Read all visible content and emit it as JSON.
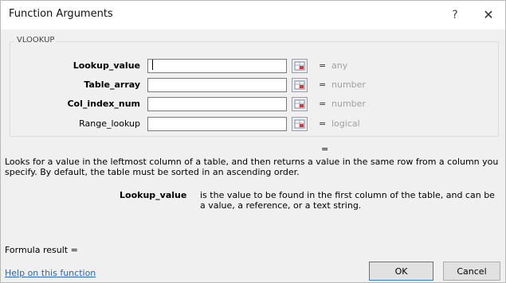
{
  "window": {
    "title": "Function Arguments",
    "help_glyph": "?",
    "close_glyph": "✕"
  },
  "group": {
    "label": "VLOOKUP"
  },
  "arguments": [
    {
      "label": "Lookup_value",
      "value": "",
      "eq": "=",
      "type": "any"
    },
    {
      "label": "Table_array",
      "value": "",
      "eq": "=",
      "type": "number"
    },
    {
      "label": "Col_index_num",
      "value": "",
      "eq": "=",
      "type": "number"
    },
    {
      "label": "Range_lookup",
      "value": "",
      "eq": "=",
      "type": "logical"
    }
  ],
  "result_eq": "=",
  "description": "Looks for a value in the leftmost column of a table, and then returns a value in the same row from a column you specify. By default, the table must be sorted in an ascending order.",
  "param": {
    "name": "Lookup_value",
    "description": "is the value to be found in the first column of the table, and can be a value, a reference, or a text string."
  },
  "formula_result": "Formula result =",
  "help_link": "Help on this function",
  "buttons": {
    "ok": "OK",
    "cancel": "Cancel"
  },
  "colors": {
    "link": "#2a66b5",
    "type_text": "#a0a0a0",
    "ok_border": "#2f7fd6"
  }
}
